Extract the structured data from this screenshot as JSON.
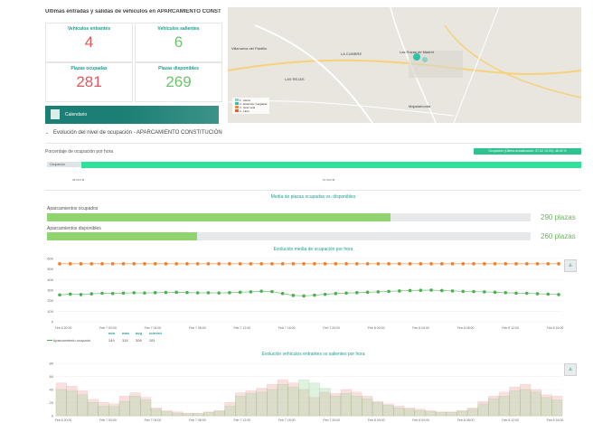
{
  "header": {
    "title": "Últimas entradas y salidas de vehículos en APARCAMIENTO CONSTI..."
  },
  "stats": {
    "entrantes": {
      "label": "Vehículos entrantes",
      "value": "4"
    },
    "salientes": {
      "label": "Vehículos salientes",
      "value": "6"
    },
    "ocupadas": {
      "label": "Plazas ocupadas",
      "value": "281"
    },
    "disponibles": {
      "label": "Plazas disponibles",
      "value": "269"
    }
  },
  "calendar": {
    "label": "Calendario"
  },
  "map": {
    "places": [
      "Villanueva del Pardillo",
      "LA CUMBRE",
      "Las Rozas de Madrid",
      "LAS REJAS",
      "Majadahonda"
    ],
    "legend": [
      "1 - Alerta",
      "2 - Estancia / Llegadas",
      "3 - Gran vela",
      "4 - Libre"
    ],
    "legend_colors": [
      "#8fd0c4",
      "#2bc4a8",
      "#f08a3c",
      "#f05a3c"
    ]
  },
  "section": {
    "title": "Evolución del nivel de ocupación - APARCAMIENTO CONSTITUCIÓN"
  },
  "occupancy_hour": {
    "title": "Porcentaje de ocupación por hora",
    "badge": "Ocupación (Última actualización: 07:02 13:00): 48.40 %",
    "row_label": "Ocupación",
    "ticks": [
      "06:00 P.M.",
      "07:00 P.M."
    ]
  },
  "media": {
    "title": "Media de plazas ocupadas vs. disponibles",
    "ocupados_label": "Aparcamientos ocupados",
    "ocupados_value": "290 plazas",
    "ocupados_fraction": 0.71,
    "disponibles_label": "Aparcamientos disponibles",
    "disponibles_value": "260 plazas",
    "disponibles_fraction": 0.31
  },
  "evolucion": {
    "title": "Evolución media de ocupación por hora",
    "legend": "Aparcamiento ocupado",
    "stats_headers": [
      "min",
      "max",
      "avg",
      "current"
    ],
    "stats_values": [
      "249",
      "316",
      "306",
      "281"
    ],
    "button_icon": "chart-up-icon"
  },
  "entrantes_chart": {
    "title": "Evolución vehículos entrantes vs salientes por hora",
    "button_icon": "chart-up-icon"
  },
  "chart_data": [
    {
      "type": "line",
      "title": "Evolución media de ocupación por hora",
      "ylim": [
        0,
        600
      ],
      "yticks": [
        0,
        100,
        200,
        300,
        400,
        500,
        600
      ],
      "xticks": [
        "Feb 6 20:00",
        "Feb 7 00:00",
        "Feb 7 04:00",
        "Feb 7 08:00",
        "Feb 7 12:00",
        "Feb 7 16:00",
        "Feb 7 20:00",
        "Feb 8 00:00",
        "Feb 8 04:00",
        "Feb 8 08:00",
        "Feb 8 12:00",
        "Feb 8 16:00"
      ],
      "series": [
        {
          "name": "capacity",
          "color": "#f07e2a",
          "values": [
            550,
            550,
            550,
            550,
            550,
            550,
            550,
            550,
            550,
            550,
            550,
            550,
            550,
            550,
            550,
            550,
            550,
            550,
            550,
            550,
            550,
            550,
            550,
            550,
            550,
            550,
            550,
            550,
            550,
            550,
            550,
            550,
            550,
            550,
            550,
            550,
            550,
            550,
            550,
            550,
            550,
            550,
            550,
            550,
            550,
            550,
            550,
            550
          ]
        },
        {
          "name": "Aparcamiento ocupado",
          "color": "#4caf50",
          "values": [
            255,
            262,
            258,
            265,
            270,
            268,
            272,
            275,
            273,
            276,
            278,
            280,
            277,
            274,
            275,
            273,
            276,
            280,
            284,
            290,
            286,
            268,
            250,
            245,
            252,
            260,
            268,
            272,
            276,
            280,
            284,
            288,
            292,
            296,
            298,
            300,
            296,
            292,
            288,
            286,
            284,
            280,
            276,
            272,
            270,
            266,
            262,
            258
          ]
        }
      ]
    },
    {
      "type": "bar",
      "title": "Evolución vehículos entrantes vs salientes por hora",
      "ylim": [
        0,
        80
      ],
      "yticks": [
        0,
        20,
        40,
        60,
        80
      ],
      "xticks": [
        "Feb 6 20:00",
        "Feb 7 00:00",
        "Feb 7 04:00",
        "Feb 7 08:00",
        "Feb 7 12:00",
        "Feb 7 16:00",
        "Feb 7 20:00",
        "Feb 8 00:00",
        "Feb 8 04:00",
        "Feb 8 08:00",
        "Feb 8 12:00",
        "Feb 8 16:00"
      ],
      "series": [
        {
          "name": "entrantes",
          "color": "#f3a5a5",
          "values": [
            50,
            45,
            38,
            25,
            20,
            18,
            30,
            35,
            28,
            12,
            8,
            6,
            4,
            4,
            6,
            8,
            20,
            35,
            38,
            42,
            48,
            55,
            50,
            40,
            28,
            36,
            34,
            40,
            36,
            30,
            22,
            18,
            15,
            12,
            10,
            8,
            6,
            6,
            8,
            12,
            22,
            30,
            36,
            44,
            48,
            40,
            32,
            30
          ]
        },
        {
          "name": "salientes",
          "color": "#a5d9a5",
          "values": [
            40,
            38,
            32,
            20,
            15,
            14,
            22,
            30,
            24,
            10,
            6,
            4,
            3,
            3,
            5,
            7,
            15,
            30,
            34,
            36,
            40,
            48,
            44,
            55,
            50,
            42,
            30,
            34,
            30,
            26,
            20,
            16,
            12,
            10,
            8,
            6,
            5,
            5,
            7,
            10,
            18,
            26,
            30,
            38,
            40,
            36,
            28,
            24
          ]
        }
      ]
    }
  ]
}
